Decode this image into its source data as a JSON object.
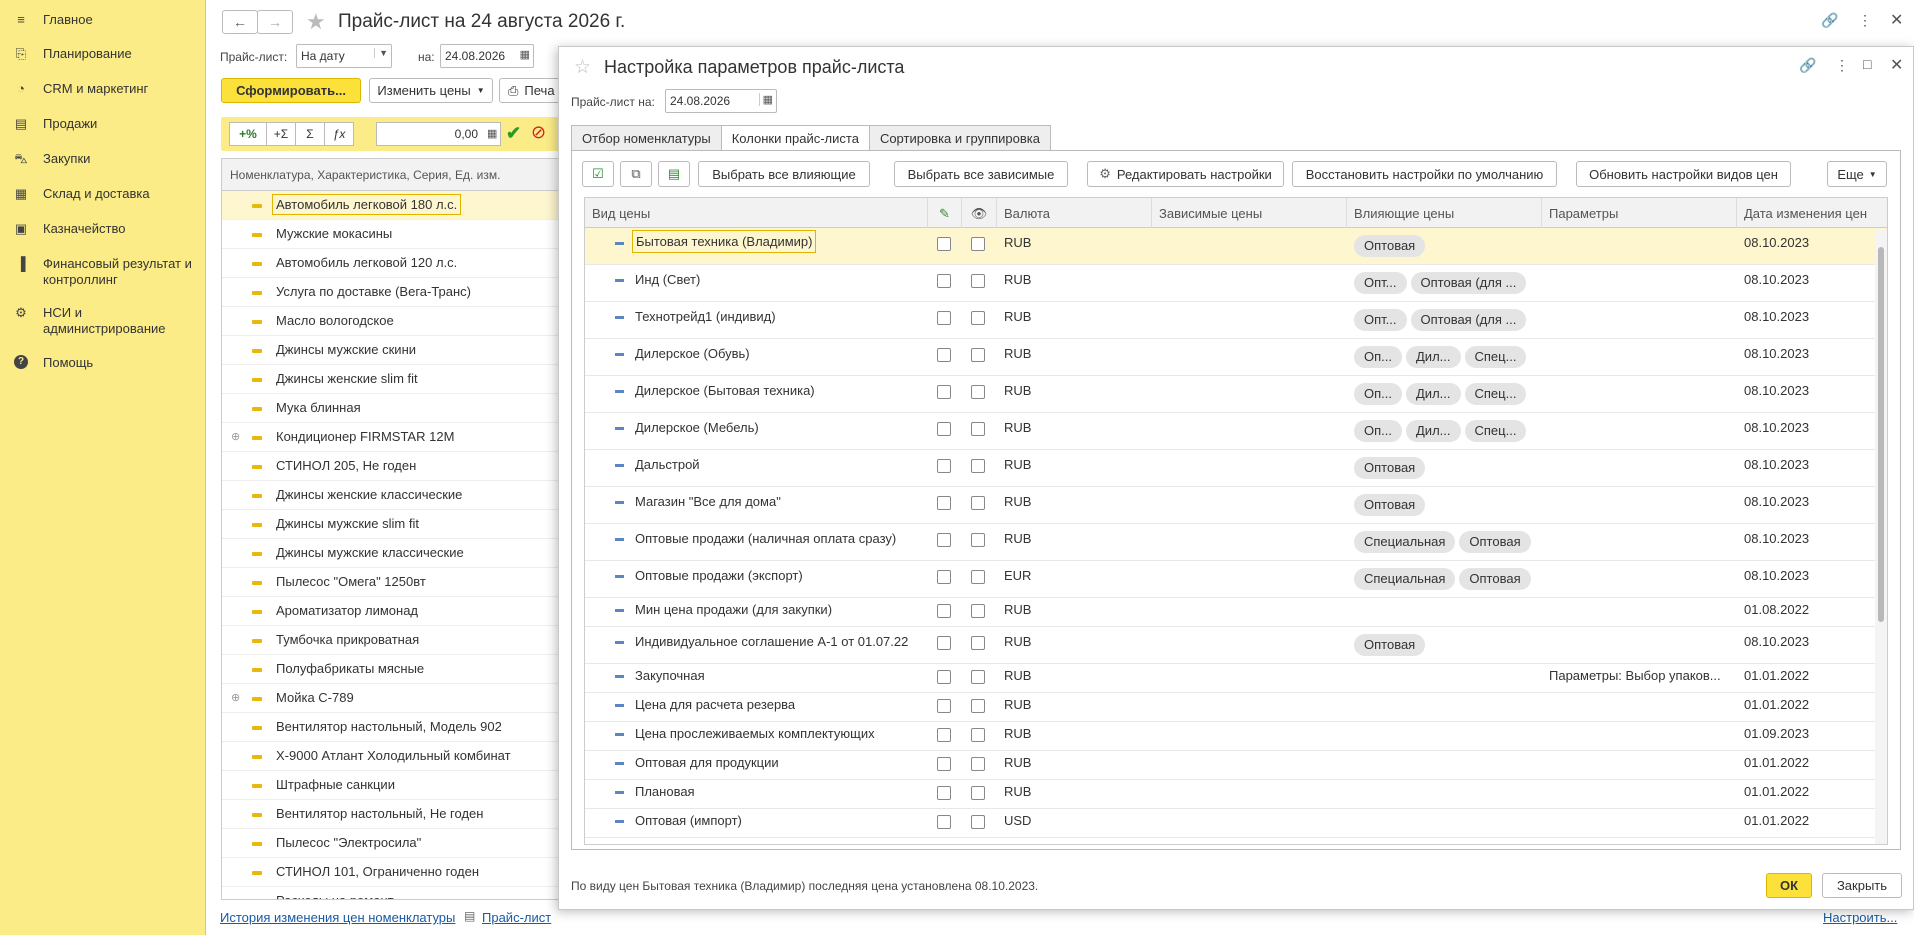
{
  "sidebar": {
    "items": [
      {
        "label": "Главное",
        "icon": "menu-icon"
      },
      {
        "label": "Планирование",
        "icon": "planning-icon"
      },
      {
        "label": "CRM и маркетинг",
        "icon": "crm-icon"
      },
      {
        "label": "Продажи",
        "icon": "sales-bag-icon"
      },
      {
        "label": "Закупки",
        "icon": "cart-icon"
      },
      {
        "label": "Склад и доставка",
        "icon": "warehouse-icon"
      },
      {
        "label": "Казначейство",
        "icon": "treasury-icon"
      },
      {
        "label": "Финансовый результат и контроллинг",
        "icon": "chart-icon"
      },
      {
        "label": "НСИ и администрирование",
        "icon": "gear-icon"
      },
      {
        "label": "Помощь",
        "icon": "help-icon"
      }
    ]
  },
  "main": {
    "title": "Прайс-лист на 24 августа 2026 г.",
    "price_list_label": "Прайс-лист:",
    "price_list_value": "На дату",
    "on_label": "на:",
    "date_value": "24.08.2026",
    "generate_button": "Сформировать...",
    "change_prices_button": "Изменить цены",
    "print_button": "Печа",
    "formula_buttons": [
      "+%",
      "+Σ",
      "Σ",
      "ƒx"
    ],
    "formula_value": "0,00",
    "list_header": "Номенклатура, Характеристика, Серия, Ед. изм.",
    "items": [
      {
        "name": "Автомобиль легковой 180 л.с.",
        "expandable": false,
        "selected": true
      },
      {
        "name": "Мужские мокасины",
        "expandable": false
      },
      {
        "name": "Автомобиль легковой 120 л.с.",
        "expandable": false
      },
      {
        "name": "Услуга по доставке (Вега-Транс)",
        "expandable": false
      },
      {
        "name": "Масло вологодское",
        "expandable": false
      },
      {
        "name": "Джинсы мужские скини",
        "expandable": false
      },
      {
        "name": "Джинсы женские slim fit",
        "expandable": false
      },
      {
        "name": "Мука блинная",
        "expandable": false
      },
      {
        "name": "Кондиционер FIRMSTAR 12M",
        "expandable": true
      },
      {
        "name": "СТИНОЛ 205, Не годен",
        "expandable": false
      },
      {
        "name": "Джинсы женские классические",
        "expandable": false
      },
      {
        "name": "Джинсы мужские slim fit",
        "expandable": false
      },
      {
        "name": "Джинсы мужские классические",
        "expandable": false
      },
      {
        "name": "Пылесос \"Омега\" 1250вт",
        "expandable": false
      },
      {
        "name": "Ароматизатор лимонад",
        "expandable": false
      },
      {
        "name": "Тумбочка прикроватная",
        "expandable": false
      },
      {
        "name": "Полуфабрикаты мясные",
        "expandable": false
      },
      {
        "name": "Мойка С-789",
        "expandable": true
      },
      {
        "name": "Вентилятор настольный, Модель 902",
        "expandable": false
      },
      {
        "name": "Х-9000 Атлант Холодильный комбинат",
        "expandable": false
      },
      {
        "name": "Штрафные санкции",
        "expandable": false
      },
      {
        "name": "Вентилятор настольный, Не годен",
        "expandable": false
      },
      {
        "name": "Пылесос \"Электросила\"",
        "expandable": false
      },
      {
        "name": "СТИНОЛ 101, Ограниченно годен",
        "expandable": false
      },
      {
        "name": "Расходы на ремонт",
        "expandable": false
      }
    ],
    "footer_link_history": "История изменения цен номенклатуры",
    "footer_link_pricelist": "Прайс-лист",
    "footer_link_settings": "Настроить..."
  },
  "modal": {
    "title": "Настройка параметров прайс-листа",
    "price_list_on_label": "Прайс-лист на:",
    "price_list_on_date": "24.08.2026",
    "tabs": [
      {
        "label": "Отбор номенклатуры",
        "active": false
      },
      {
        "label": "Колонки прайс-листа",
        "active": true
      },
      {
        "label": "Сортировка и группировка",
        "active": false
      }
    ],
    "toolbar": {
      "select_all_influencing": "Выбрать все влияющие",
      "select_all_dependent": "Выбрать все зависимые",
      "edit_settings": "Редактировать настройки",
      "restore_defaults": "Восстановить настройки по умолчанию",
      "update_price_types": "Обновить настройки видов цен",
      "more": "Еще"
    },
    "columns": [
      "Вид цены",
      "Валюта",
      "Зависимые цены",
      "Влияющие цены",
      "Параметры",
      "Дата изменения цен"
    ],
    "rows": [
      {
        "name": "Бытовая техника (Владимир)",
        "currency": "RUB",
        "influencing": [
          "Оптовая"
        ],
        "params": "",
        "date": "08.10.2023",
        "selected": true
      },
      {
        "name": "Инд (Свет)",
        "currency": "RUB",
        "influencing": [
          "Опт...",
          "Оптовая (для ..."
        ],
        "params": "",
        "date": "08.10.2023"
      },
      {
        "name": "Технотрейд1 (индивид)",
        "currency": "RUB",
        "influencing": [
          "Опт...",
          "Оптовая (для ..."
        ],
        "params": "",
        "date": "08.10.2023"
      },
      {
        "name": "Дилерское (Обувь)",
        "currency": "RUB",
        "influencing": [
          "Оп...",
          "Дил...",
          "Спец..."
        ],
        "params": "",
        "date": "08.10.2023"
      },
      {
        "name": "Дилерское (Бытовая техника)",
        "currency": "RUB",
        "influencing": [
          "Оп...",
          "Дил...",
          "Спец..."
        ],
        "params": "",
        "date": "08.10.2023"
      },
      {
        "name": "Дилерское (Мебель)",
        "currency": "RUB",
        "influencing": [
          "Оп...",
          "Дил...",
          "Спец..."
        ],
        "params": "",
        "date": "08.10.2023"
      },
      {
        "name": "Дальстрой",
        "currency": "RUB",
        "influencing": [
          "Оптовая"
        ],
        "params": "",
        "date": "08.10.2023"
      },
      {
        "name": "Магазин \"Все для дома\"",
        "currency": "RUB",
        "influencing": [
          "Оптовая"
        ],
        "params": "",
        "date": "08.10.2023"
      },
      {
        "name": "Оптовые продажи (наличная оплата сразу)",
        "currency": "RUB",
        "influencing": [
          "Специальная",
          "Оптовая"
        ],
        "params": "",
        "date": "08.10.2023"
      },
      {
        "name": "Оптовые продажи (экспорт)",
        "currency": "EUR",
        "influencing": [
          "Специальная",
          "Оптовая"
        ],
        "params": "",
        "date": "08.10.2023"
      },
      {
        "name": "Мин цена продажи (для закупки)",
        "currency": "RUB",
        "influencing": [],
        "params": "",
        "date": "01.08.2022"
      },
      {
        "name": "Индивидуальное соглашение А-1 от 01.07.22",
        "currency": "RUB",
        "influencing": [
          "Оптовая"
        ],
        "params": "",
        "date": "08.10.2023"
      },
      {
        "name": "Закупочная",
        "currency": "RUB",
        "influencing": [],
        "params": "Параметры: Выбор упаков...",
        "date": "01.01.2022"
      },
      {
        "name": "Цена для расчета резерва",
        "currency": "RUB",
        "influencing": [],
        "params": "",
        "date": "01.01.2022"
      },
      {
        "name": "Цена прослеживаемых комплектующих",
        "currency": "RUB",
        "influencing": [],
        "params": "",
        "date": "01.09.2023"
      },
      {
        "name": "Оптовая для продукции",
        "currency": "RUB",
        "influencing": [],
        "params": "",
        "date": "01.01.2022"
      },
      {
        "name": "Плановая",
        "currency": "RUB",
        "influencing": [],
        "params": "",
        "date": "01.01.2022"
      },
      {
        "name": "Оптовая (импорт)",
        "currency": "USD",
        "influencing": [],
        "params": "",
        "date": "01.01.2022"
      }
    ],
    "status_text": "По виду цен Бытовая техника (Владимир) последняя цена установлена 08.10.2023.",
    "ok_button": "ОК",
    "close_button": "Закрыть"
  }
}
